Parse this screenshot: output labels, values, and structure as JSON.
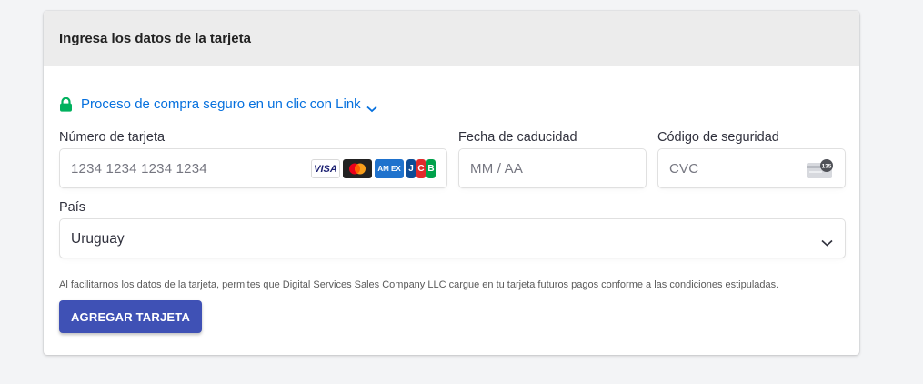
{
  "header": {
    "title": "Ingresa los datos de la tarjeta"
  },
  "link": {
    "text": "Proceso de compra seguro en un clic con Link",
    "color": "#0570de",
    "lock_color": "#00b15e"
  },
  "card_number": {
    "label": "Número de tarjeta",
    "placeholder": "1234 1234 1234 1234",
    "brands": [
      "visa-icon",
      "mastercard-icon",
      "amex-icon",
      "jcb-icon"
    ],
    "visa_text": "VISA",
    "amex_text": "AM EX",
    "jcb_text": [
      "J",
      "C",
      "B"
    ]
  },
  "expiry": {
    "label": "Fecha de caducidad",
    "placeholder": "MM / AA"
  },
  "cvc": {
    "label": "Código de seguridad",
    "placeholder": "CVC",
    "icon_text": "135"
  },
  "country": {
    "label": "País",
    "value": "Uruguay"
  },
  "terms": "Al facilitarnos los datos de la tarjeta, permites que Digital Services Sales Company LLC cargue en tu tarjeta futuros pagos conforme a las condiciones estipuladas.",
  "submit": {
    "label": "AGREGAR TARJETA",
    "color": "#3f51b5"
  }
}
